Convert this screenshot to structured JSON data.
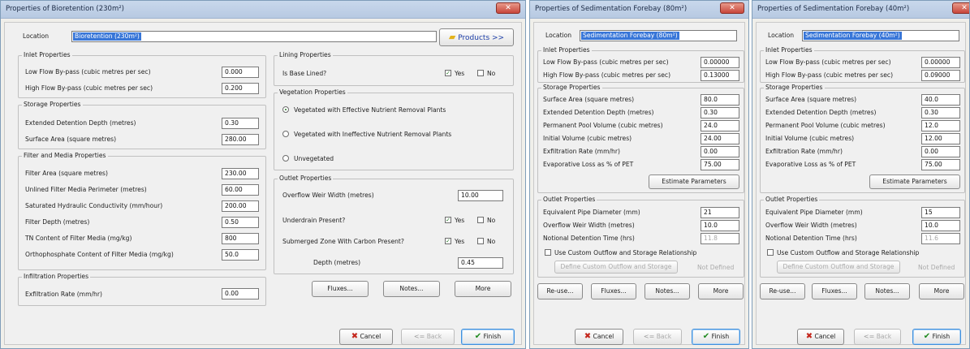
{
  "windows": [
    {
      "title": "Properties of Bioretention (230m²)",
      "location_label": "Location",
      "location_value": "Bioretention (230m²)",
      "products_label": "Products >>",
      "inlet": {
        "title": "Inlet Properties",
        "rows": [
          {
            "label": "Low Flow By-pass (cubic metres per sec)",
            "value": "0.000"
          },
          {
            "label": "High Flow By-pass (cubic metres per sec)",
            "value": "0.200"
          }
        ]
      },
      "storage": {
        "title": "Storage Properties",
        "rows": [
          {
            "label": "Extended Detention Depth (metres)",
            "value": "0.30"
          },
          {
            "label": "Surface Area (square metres)",
            "value": "280.00"
          }
        ]
      },
      "filter": {
        "title": "Filter and Media Properties",
        "rows": [
          {
            "label": "Filter Area (square metres)",
            "value": "230.00"
          },
          {
            "label": "Unlined Filter Media Perimeter (metres)",
            "value": "60.00"
          },
          {
            "label": "Saturated Hydraulic Conductivity (mm/hour)",
            "value": "200.00"
          },
          {
            "label": "Filter Depth (metres)",
            "value": "0.50"
          },
          {
            "label": "TN Content of Filter Media (mg/kg)",
            "value": "800"
          },
          {
            "label": "Orthophosphate Content of Filter Media (mg/kg)",
            "value": "50.0"
          }
        ]
      },
      "infiltration": {
        "title": "Infiltration Properties",
        "rows": [
          {
            "label": "Exfiltration Rate (mm/hr)",
            "value": "0.00"
          }
        ]
      },
      "lining": {
        "title": "Lining Properties",
        "question": "Is Base Lined?",
        "yes": "Yes",
        "no": "No"
      },
      "vegetation": {
        "title": "Vegetation Properties",
        "options": [
          "Vegetated with Effective Nutrient Removal Plants",
          "Vegetated with Ineffective Nutrient Removal Plants",
          "Unvegetated"
        ]
      },
      "outlet": {
        "title": "Outlet Properties",
        "weir_label": "Overflow Weir Width (metres)",
        "weir_value": "10.00",
        "underdrain_label": "Underdrain Present?",
        "submerged_label": "Submerged Zone With Carbon Present?",
        "depth_label": "Depth (metres)",
        "depth_value": "0.45",
        "yes": "Yes",
        "no": "No"
      },
      "buttons": {
        "fluxes": "Fluxes...",
        "notes": "Notes...",
        "more": "More",
        "cancel": "Cancel",
        "back": "Back",
        "finish": "Finish"
      }
    },
    {
      "title": "Properties of Sedimentation Forebay (80m²)",
      "location_label": "Location",
      "location_value": "Sedimentation Forebay (80m²)",
      "inlet": {
        "title": "Inlet Properties",
        "rows": [
          {
            "label": "Low Flow By-pass (cubic metres per sec)",
            "value": "0.00000"
          },
          {
            "label": "High Flow By-pass (cubic metres per sec)",
            "value": "0.13000"
          }
        ]
      },
      "storage": {
        "title": "Storage Properties",
        "rows": [
          {
            "label": "Surface Area (square metres)",
            "value": "80.0"
          },
          {
            "label": "Extended Detention Depth (metres)",
            "value": "0.30"
          },
          {
            "label": "Permanent Pool Volume (cubic metres)",
            "value": "24.0"
          },
          {
            "label": "Initial Volume (cubic metres)",
            "value": "24.00"
          },
          {
            "label": "Exfiltration Rate (mm/hr)",
            "value": "0.00"
          },
          {
            "label": "Evaporative Loss as % of PET",
            "value": "75.00"
          }
        ],
        "estimate": "Estimate Parameters"
      },
      "outlet": {
        "title": "Outlet Properties",
        "rows": [
          {
            "label": "Equivalent Pipe Diameter (mm)",
            "value": "21"
          },
          {
            "label": "Overflow Weir Width (metres)",
            "value": "10.0"
          },
          {
            "label": "Notional Detention Time (hrs)",
            "value": "11.8"
          }
        ],
        "custom_label": "Use Custom Outflow and Storage Relationship",
        "define_label": "Define Custom Outflow and Storage",
        "not_defined": "Not Defined"
      },
      "buttons": {
        "reuse": "Re-use...",
        "fluxes": "Fluxes...",
        "notes": "Notes...",
        "more": "More",
        "cancel": "Cancel",
        "back": "Back",
        "finish": "Finish"
      }
    },
    {
      "title": "Properties of Sedimentation Forebay (40m²)",
      "location_label": "Location",
      "location_value": "Sedimentation Forebay (40m²)",
      "inlet": {
        "title": "Inlet Properties",
        "rows": [
          {
            "label": "Low Flow By-pass (cubic metres per sec)",
            "value": "0.00000"
          },
          {
            "label": "High Flow By-pass (cubic metres per sec)",
            "value": "0.09000"
          }
        ]
      },
      "storage": {
        "title": "Storage Properties",
        "rows": [
          {
            "label": "Surface Area (square metres)",
            "value": "40.0"
          },
          {
            "label": "Extended Detention Depth (metres)",
            "value": "0.30"
          },
          {
            "label": "Permanent Pool Volume (cubic metres)",
            "value": "12.0"
          },
          {
            "label": "Initial Volume (cubic metres)",
            "value": "12.00"
          },
          {
            "label": "Exfiltration Rate (mm/hr)",
            "value": "0.00"
          },
          {
            "label": "Evaporative Loss as % of PET",
            "value": "75.00"
          }
        ],
        "estimate": "Estimate Parameters"
      },
      "outlet": {
        "title": "Outlet Properties",
        "rows": [
          {
            "label": "Equivalent Pipe Diameter (mm)",
            "value": "15"
          },
          {
            "label": "Overflow Weir Width (metres)",
            "value": "10.0"
          },
          {
            "label": "Notional Detention Time (hrs)",
            "value": "11.6"
          }
        ],
        "custom_label": "Use Custom Outflow and Storage Relationship",
        "define_label": "Define Custom Outflow and Storage",
        "not_defined": "Not Defined"
      },
      "buttons": {
        "reuse": "Re-use...",
        "fluxes": "Fluxes...",
        "notes": "Notes...",
        "more": "More",
        "cancel": "Cancel",
        "back": "Back",
        "finish": "Finish"
      }
    }
  ],
  "icons": {
    "close": "close-icon",
    "products": "folder-icon",
    "cancel": "x-icon",
    "back": "back-arrow-icon",
    "finish": "checkmark-icon"
  }
}
